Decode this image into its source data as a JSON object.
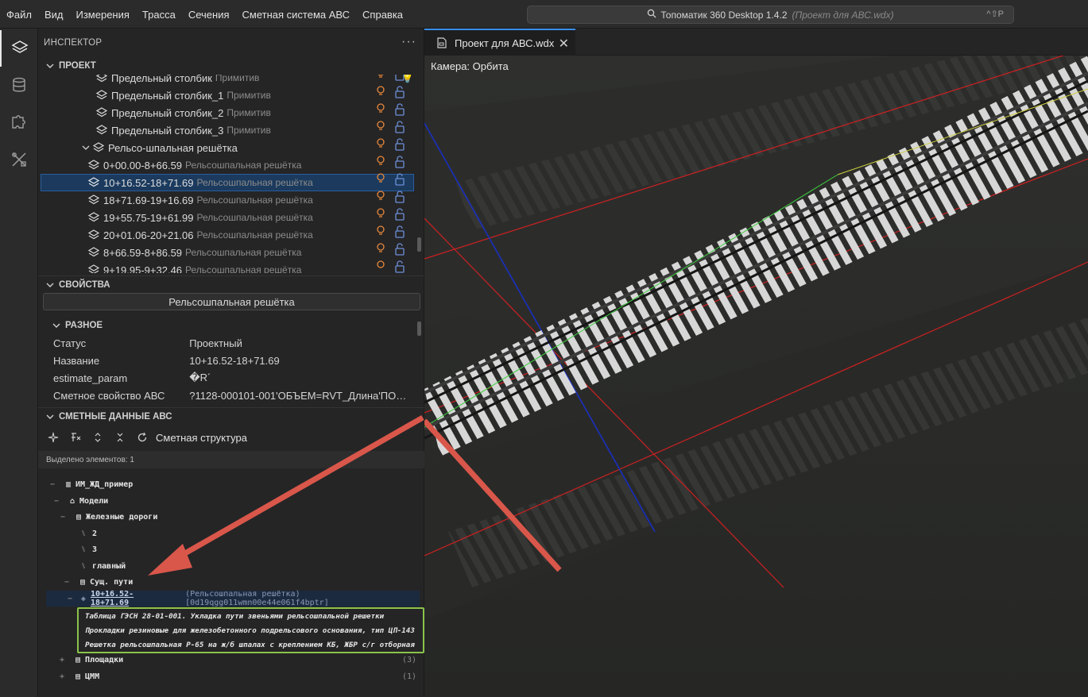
{
  "menu": [
    "Файл",
    "Вид",
    "Измерения",
    "Трасса",
    "Сечения",
    "Сметная система АВС",
    "Справка"
  ],
  "search": {
    "title": "Топоматик 360 Desktop 1.4.2",
    "project": "(Проект для АВС.wdx)",
    "shortcut": "^⇧P"
  },
  "activity_bar": [
    "layers-icon",
    "database-icon",
    "puzzle-icon",
    "tools-icon"
  ],
  "inspector": {
    "title": "ИНСПЕКТОР",
    "project_section": "ПРОЕКТ",
    "tree": [
      {
        "name": "Предельный столбик",
        "type": "Примитив"
      },
      {
        "name": "Предельный столбик_1",
        "type": "Примитив"
      },
      {
        "name": "Предельный столбик_2",
        "type": "Примитив"
      },
      {
        "name": "Предельный столбик_3",
        "type": "Примитив"
      },
      {
        "name": "Рельсо-шпальная решётка",
        "type": ""
      },
      {
        "name": "0+00.00-8+66.59",
        "type": "Рельсошпальная решётка"
      },
      {
        "name": "10+16.52-18+71.69",
        "type": "Рельсошпальная решётка"
      },
      {
        "name": "18+71.69-19+16.69",
        "type": "Рельсошпальная решётка"
      },
      {
        "name": "19+55.75-19+61.99",
        "type": "Рельсошпальная решётка"
      },
      {
        "name": "20+01.06-20+21.06",
        "type": "Рельсошпальная решётка"
      },
      {
        "name": "8+66.59-8+86.59",
        "type": "Рельсошпальная решётка"
      },
      {
        "name": "9+19.95-9+32.46",
        "type": "Рельсошпальная решётка"
      }
    ]
  },
  "properties": {
    "section": "СВОЙСТВА",
    "type_button": "Рельсошпальная решётка",
    "group": "РАЗНОЕ",
    "rows": [
      {
        "k": "Статус",
        "v": "Проектный"
      },
      {
        "k": "Название",
        "v": "10+16.52-18+71.69"
      },
      {
        "k": "estimate_param",
        "v": "�R´"
      },
      {
        "k": "Сметное свойство АВС",
        "v": "?1128-000101-001'ОБЪЕМ=RVT_Длина'ПОП…"
      }
    ]
  },
  "estimate": {
    "section": "СМЕТНЫЕ ДАННЫЕ АВС",
    "toolbar_label": "Сметная структура",
    "selected_count": "Выделено элементов: 1",
    "tree": {
      "root": "ИМ_ЖД_пример",
      "models": "Модели",
      "railways": "Железные дороги",
      "r2": "2",
      "r3": "3",
      "main": "главный",
      "existing": "Сущ. пути",
      "node": "10+16.52-18+71.69",
      "node_meta": "(Рельсошпальная решётка) [0d19qgg011wmn00e44e061f4bptr]",
      "items": [
        "Таблица ГЭСН 28-01-001. Укладка пути звеньями рельсошпальной решетки",
        "Прокладки резиновые для железобетонного подрельсового основания, тип ЦП-143",
        "Решетка рельсошпальная Р-65 на ж/б шпалах с креплением КБ, ЖБР с/г отборная"
      ],
      "sites": "Площадки",
      "sites_count": "(3)",
      "dtm": "ЦММ",
      "dtm_count": "(1)"
    }
  },
  "editor": {
    "tab": "Проект для АВС.wdx",
    "camera": "Камера: Орбита"
  },
  "colors": {
    "accent": "#3b8eea",
    "highlight_box": "#8bc34a",
    "arrow": "#d9574a",
    "bulb": "#e8873a",
    "lock": "#6d8fd6"
  }
}
